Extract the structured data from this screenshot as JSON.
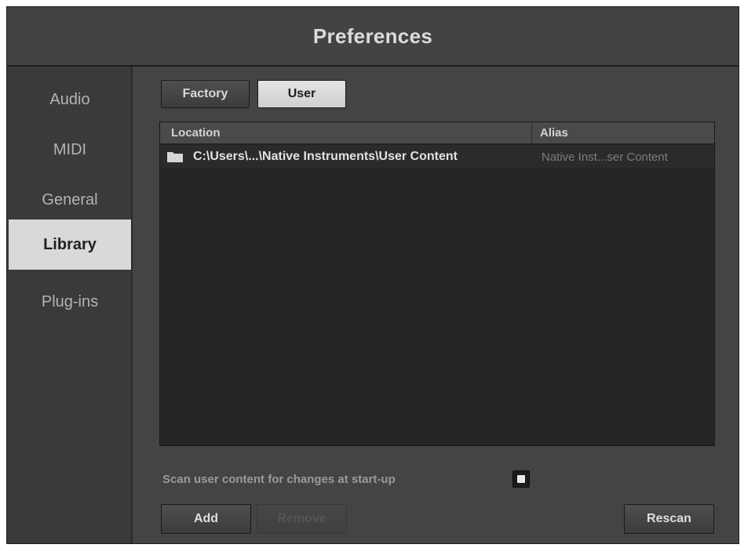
{
  "window": {
    "title": "Preferences"
  },
  "sidebar": {
    "items": [
      {
        "label": "Audio",
        "active": false
      },
      {
        "label": "MIDI",
        "active": false
      },
      {
        "label": "General",
        "active": false
      },
      {
        "label": "Library",
        "active": true
      },
      {
        "label": "Plug-ins",
        "active": false
      }
    ]
  },
  "library": {
    "tabs": [
      {
        "label": "Factory",
        "selected": false
      },
      {
        "label": "User",
        "selected": true
      }
    ],
    "table": {
      "columns": [
        "Location",
        "Alias"
      ],
      "rows": [
        {
          "icon": "folder-icon",
          "location": "C:\\Users\\...\\Native Instruments\\User Content",
          "alias": "Native Inst...ser Content"
        }
      ]
    },
    "scan_option": {
      "label": "Scan user content for changes at start-up",
      "checked": true
    },
    "buttons": {
      "add": "Add",
      "remove": "Remove",
      "remove_enabled": false,
      "rescan": "Rescan"
    }
  },
  "colors": {
    "window_bg": "#3c3c3c",
    "active_item_bg": "#d9d9d9",
    "table_bg": "#252525"
  }
}
